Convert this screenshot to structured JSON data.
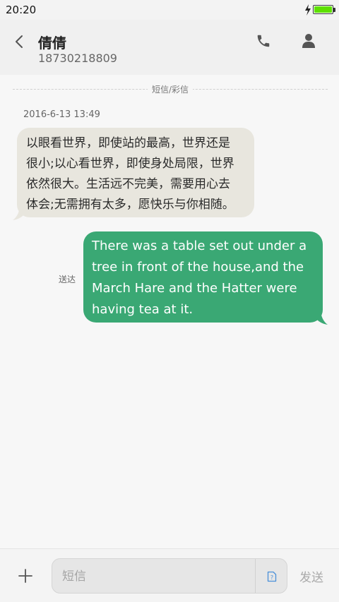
{
  "status_bar": {
    "time": "20:20",
    "battery_level": 1.0
  },
  "header": {
    "contact_name": "倩倩",
    "contact_number": "18730218809"
  },
  "thread": {
    "message_type_divider": "短信/彩信",
    "timestamp": "2016-6-13 13:49",
    "incoming_message": {
      "lines": [
        "以眼看世界，即使站的最高，世界还是",
        "很小;以心看世界，即使身处局限，世界",
        "依然很大。生活远不完美，需要用心去",
        "体会;无需拥有太多，愿快乐与你相随。"
      ]
    },
    "outgoing_message": {
      "status": "送达",
      "lines": [
        "There was a table set out under a",
        "tree in front of the house,and the",
        "March Hare and the Hatter were",
        "having tea at it."
      ]
    }
  },
  "composer": {
    "placeholder": "短信",
    "value": "",
    "send_label": "发送"
  },
  "colors": {
    "incoming_bubble": "#e8e6de",
    "outgoing_bubble": "#3aa874",
    "battery_fill": "#5ee000",
    "sim_badge": "#4a90d9"
  },
  "icons": [
    "back-icon",
    "phone-icon",
    "person-icon",
    "bolt-icon",
    "battery-icon",
    "plus-icon",
    "sim-card-icon"
  ]
}
